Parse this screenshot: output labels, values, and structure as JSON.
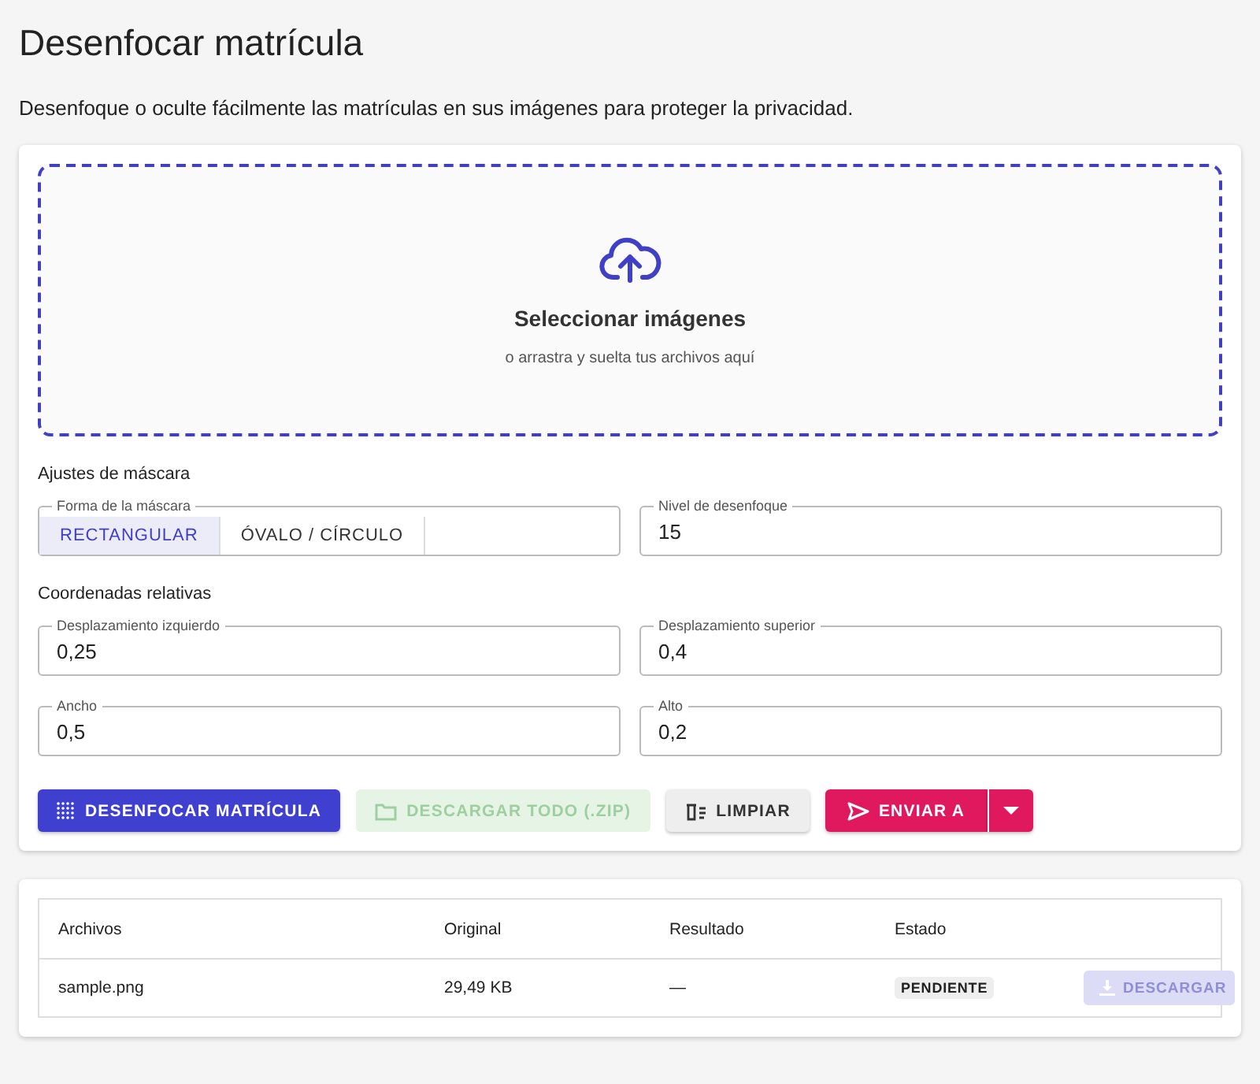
{
  "page": {
    "title": "Desenfocar matrícula",
    "description": "Desenfoque o oculte fácilmente las matrículas en sus imágenes para proteger la privacidad."
  },
  "dropzone": {
    "title": "Seleccionar imágenes",
    "hint": "o arrastra y suelta tus archivos aquí"
  },
  "mask_settings": {
    "heading": "Ajustes de máscara",
    "shape": {
      "label": "Forma de la máscara",
      "options": [
        {
          "label": "RECTANGULAR",
          "selected": true
        },
        {
          "label": "ÓVALO / CÍRCULO",
          "selected": false
        }
      ]
    },
    "blur_level": {
      "label": "Nivel de desenfoque",
      "value": "15"
    }
  },
  "coordinates": {
    "heading": "Coordenadas relativas",
    "fields": [
      {
        "label": "Desplazamiento izquierdo",
        "value": "0,25"
      },
      {
        "label": "Desplazamiento superior",
        "value": "0,4"
      },
      {
        "label": "Ancho",
        "value": "0,5"
      },
      {
        "label": "Alto",
        "value": "0,2"
      }
    ]
  },
  "actions": [
    {
      "kind": "primary",
      "label": "DESENFOCAR MATRÍCULA",
      "disabled": false
    },
    {
      "kind": "success",
      "label": "DESCARGAR TODO (.ZIP)",
      "disabled": true
    },
    {
      "kind": "plain",
      "label": "LIMPIAR",
      "disabled": false
    },
    {
      "kind": "split",
      "label": "ENVIAR A",
      "disabled": false
    }
  ],
  "table": {
    "columns": [
      "Archivos",
      "Original",
      "Resultado",
      "Estado"
    ],
    "rows": [
      {
        "file": "sample.png",
        "original": "29,49 KB",
        "result": "—",
        "status": "PENDIENTE",
        "download": {
          "label": "DESCARGAR",
          "disabled": true
        }
      }
    ]
  }
}
